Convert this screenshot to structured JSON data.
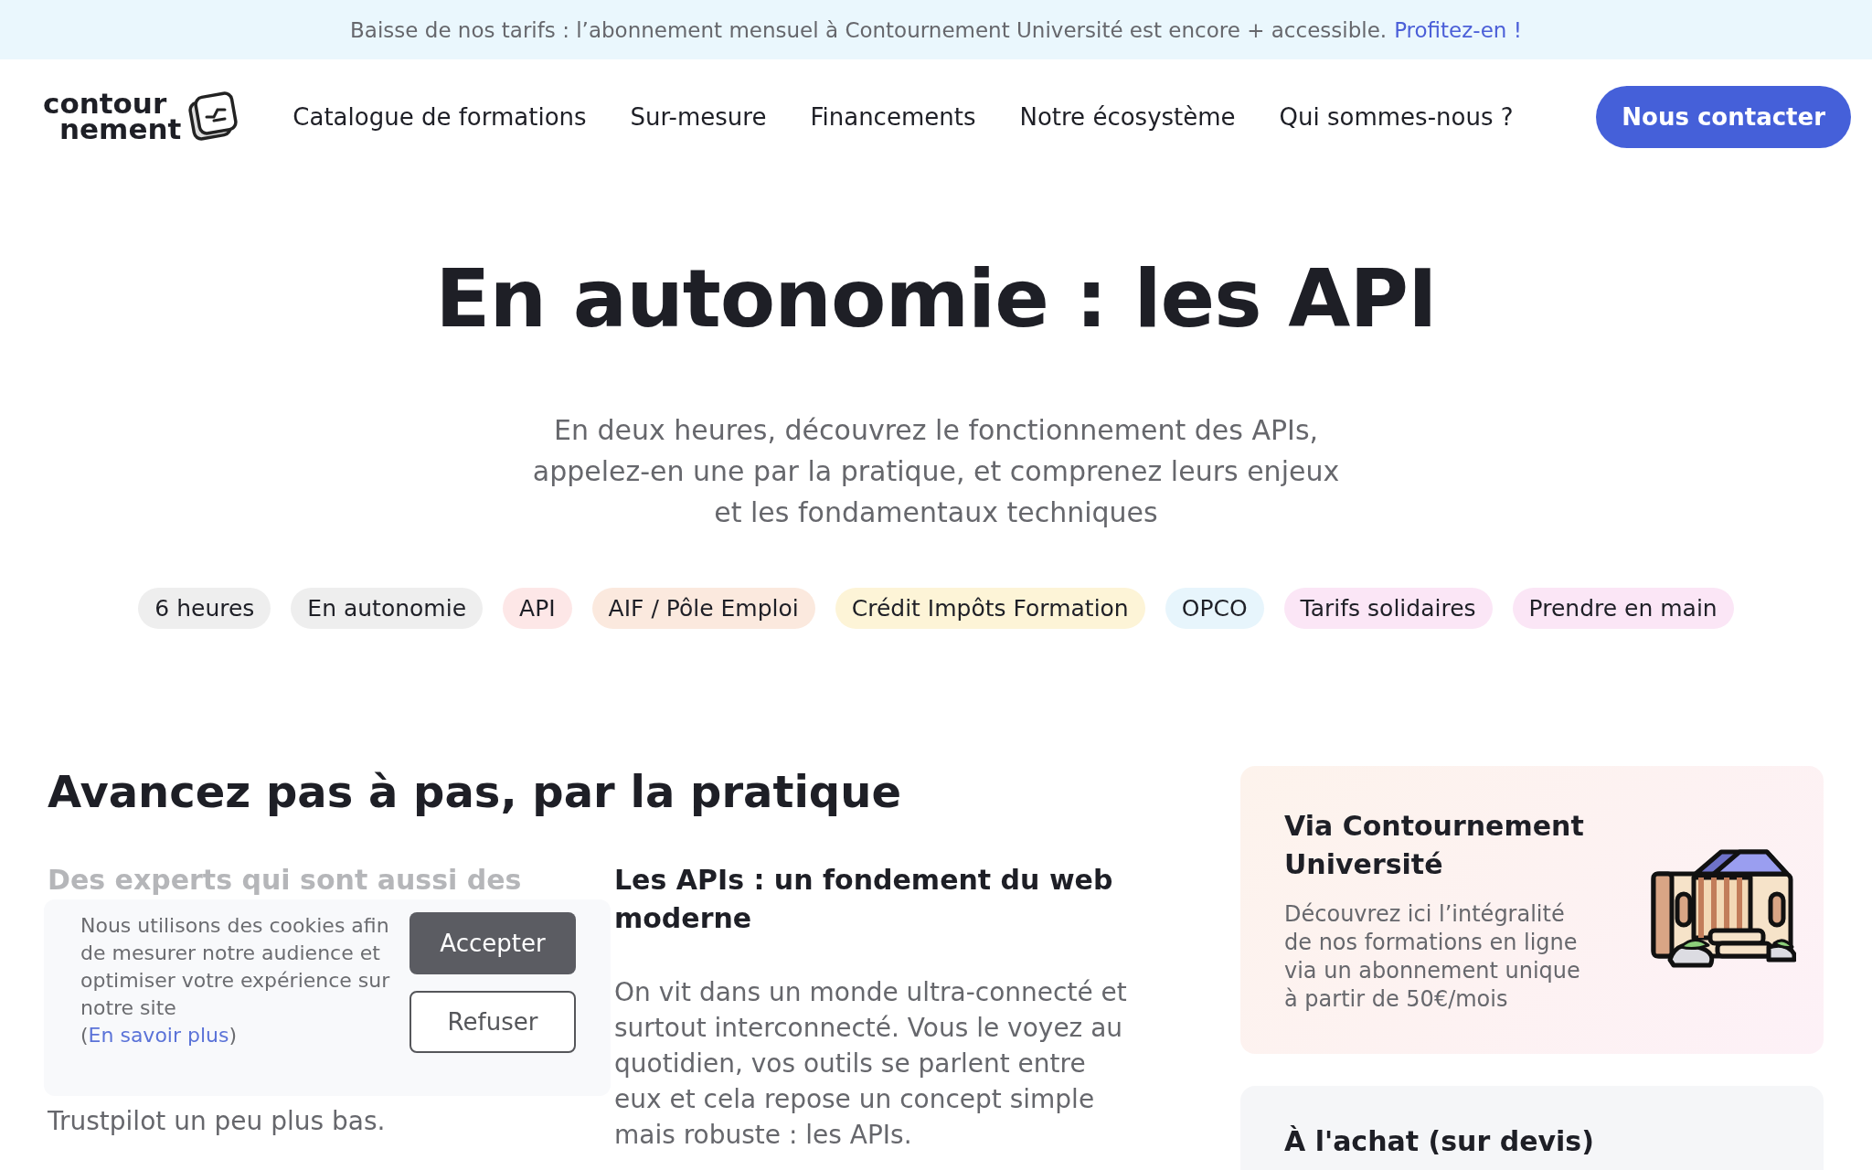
{
  "announcement": {
    "text": "Baisse de nos tarifs : l’abonnement mensuel à Contournement Université est encore + accessible.",
    "link": "Profitez-en !"
  },
  "header": {
    "logo": [
      "contour",
      "nement"
    ],
    "nav": [
      "Catalogue de formations",
      "Sur-mesure",
      "Financements",
      "Notre écosystème",
      "Qui sommes-nous ?"
    ],
    "cta": "Nous contacter"
  },
  "hero": {
    "title": "En autonomie : les API",
    "subtitle": [
      "En deux heures, découvrez le fonctionnement des APIs,",
      "appelez-en une par la pratique, et comprenez leurs enjeux",
      "et les fondamentaux techniques"
    ],
    "tags": [
      {
        "label": "6 heures",
        "color": "#eeeeee"
      },
      {
        "label": "En autonomie",
        "color": "#eeeeee"
      },
      {
        "label": "API",
        "color": "#fde7e7"
      },
      {
        "label": "AIF / Pôle Emploi",
        "color": "#fbe9de"
      },
      {
        "label": "Crédit Impôts Formation",
        "color": "#fdf4d7"
      },
      {
        "label": "OPCO",
        "color": "#e7f5fc"
      },
      {
        "label": "Tarifs solidaires",
        "color": "#fbe6f6"
      },
      {
        "label": "Prendre en main",
        "color": "#fbe6f6"
      }
    ]
  },
  "section": {
    "title": "Avancez pas à pas, par la pratique",
    "columns": [
      {
        "title": "Des experts qui sont aussi des",
        "text": "Trustpilot un peu plus bas."
      },
      {
        "title": "Les APIs : un fondement du web moderne",
        "text": "On vit dans un monde ultra-connecté et surtout interconnecté. Vous le voyez au quotidien, vos outils se parlent entre eux et cela repose un concept simple mais robuste : les APIs."
      }
    ]
  },
  "offers": [
    {
      "title": "Via Contournement Université",
      "text": "Découvrez ici l’intégralité de nos formations en ligne via un abonnement unique à partir de 50€/mois"
    },
    {
      "title": "À l'achat (sur devis)"
    }
  ],
  "cookie_banner": {
    "text": "Nous utilisons des cookies afin de mesurer notre audience et optimiser votre expérience sur notre site",
    "link_open": "(",
    "link": "En savoir plus",
    "link_close": ")",
    "accept": "Accepter",
    "refuse": "Refuser"
  }
}
